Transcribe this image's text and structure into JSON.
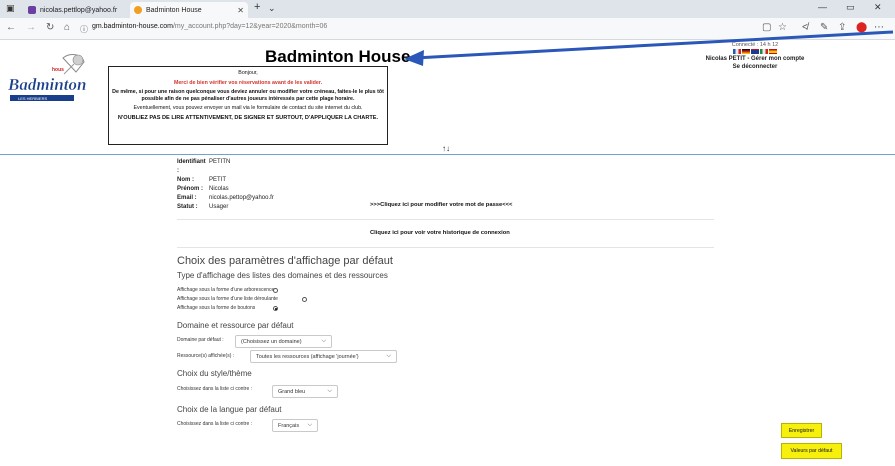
{
  "browser": {
    "tabs": [
      {
        "label": "nicolas.pettlop@yahoo.fr",
        "fav_color": "#6b3fa0"
      },
      {
        "label": "Badminton House",
        "fav_color": "#f0a020"
      }
    ],
    "new_tab": "+",
    "url_host": "gm.badminton-house.com",
    "url_path": "/my_account.php?day=12&year=2020&month=06"
  },
  "header": {
    "title": "Badminton House",
    "logo_text": "Badminton",
    "logo_sub": "LES HERBIERS",
    "right_line1": "Connecté : 14 h 12",
    "user_line": "Nicolas PETIT - Gérer mon compte",
    "logout": "Se déconnecter",
    "swap_icon": "↑↓",
    "flag_colors": [
      "#1d5ab8",
      "#e8e8e8",
      "#d02020",
      "#111111",
      "#d02020",
      "#f2c500",
      "#1a3a8c",
      "#c8102e",
      "#1d8c3c",
      "#e8e8e8",
      "#d02020",
      "#c60b1e",
      "#f2c500"
    ]
  },
  "notice": {
    "hello": "Bonjour,",
    "verify": "Merci de bien vérifier vos réservations avant de les valider.",
    "cancel": "De même, si pour une raison quelconque vous deviez annuler ou modifier votre créneau, faites-le le plus tôt possible afin de ne pas pénaliser d'autres joueurs intéressés par cette plage horaire.",
    "mail": "Eventuellement, vous pouvez envoyer un mail via le formulaire de contact du site internet du club.",
    "charter": "N'OUBLIEZ PAS DE LIRE ATTENTIVEMENT, DE SIGNER ET SURTOUT, D'APPLIQUER LA CHARTE."
  },
  "account": {
    "fields": [
      {
        "label": "Identifiant :",
        "value": "PETITN"
      },
      {
        "label": "Nom :",
        "value": "PETIT"
      },
      {
        "label": "Prénom :",
        "value": "Nicolas"
      },
      {
        "label": "Email :",
        "value": "nicolas.pettop@yahoo.fr"
      },
      {
        "label": "Statut :",
        "value": "Usager"
      }
    ],
    "password_link": ">>>Cliquez ici pour modifier votre mot de passe<<<",
    "history_link": "Cliquez ici pour voir votre historique de connexion"
  },
  "settings": {
    "title": "Choix des paramètres d'affichage par défaut",
    "list_type_title": "Type d'affichage des listes des domaines et des ressources",
    "options": [
      {
        "label": "Affichage sous la forme d'une arborescence",
        "checked": false
      },
      {
        "label": "Affichage sous la forme d'une liste déroulante",
        "checked": false
      },
      {
        "label": "Affichage sous la forme de boutons",
        "checked": true
      }
    ],
    "default_title": "Domaine et ressource par défaut",
    "domain_label": "Domaine par défaut :",
    "domain_value": "(Choisissez un domaine)",
    "resource_label": "Ressource(s) affichée(s) :",
    "resource_value": "Toutes les ressources (affichage 'journée')",
    "style_title": "Choix du style/thème",
    "style_label": "Choisissez dans la liste ci contre :",
    "style_value": "Grand bleu",
    "lang_title": "Choix de la langue par défaut",
    "lang_label": "Choisissez dans la liste ci contre :",
    "lang_value": "Français",
    "save_button": "Enregistrer",
    "defaults_button": "Valeurs par défaut"
  },
  "colors": {
    "accent_line": "#6fa3c9",
    "button_yellow": "#f6f00c",
    "notice_red": "#d0342c"
  }
}
